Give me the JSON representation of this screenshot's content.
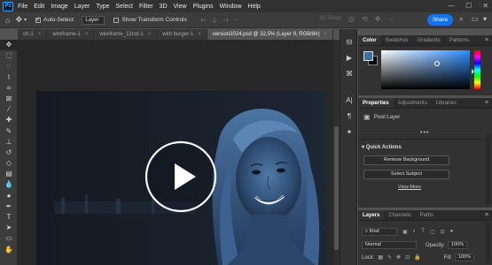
{
  "app": {
    "logo": "Ps"
  },
  "menu": [
    "File",
    "Edit",
    "Image",
    "Layer",
    "Type",
    "Select",
    "Filter",
    "3D",
    "View",
    "Plugins",
    "Window",
    "Help"
  ],
  "window_controls": {
    "minimize": "—",
    "maximize": "☐",
    "close": "✕"
  },
  "options": {
    "auto_select_label": "Auto-Select:",
    "auto_select_checked": true,
    "auto_select_value": "Layer",
    "transform_label": "Show Transform Controls",
    "transform_checked": false,
    "mode_3d_label": "3D Mode:",
    "share_label": "Share"
  },
  "tabs": [
    {
      "label": "ch-1",
      "active": false
    },
    {
      "label": "wireframe-1",
      "active": false
    },
    {
      "label": "wireframe_12col-1",
      "active": false
    },
    {
      "label": "with burger-1",
      "active": false
    },
    {
      "label": "version2024.psd @ 32,5% (Layer 9, RGB/8#)",
      "active": true
    }
  ],
  "tab_close": "×",
  "tools": [
    "move-tool-icon",
    "marquee-tool-icon",
    "lasso-tool-icon",
    "quick-select-tool-icon",
    "crop-tool-icon",
    "frame-tool-icon",
    "eyedropper-tool-icon",
    "healing-brush-tool-icon",
    "brush-tool-icon",
    "clone-stamp-tool-icon",
    "history-brush-tool-icon",
    "eraser-tool-icon",
    "gradient-tool-icon",
    "blur-tool-icon",
    "dodge-tool-icon",
    "pen-tool-icon",
    "type-tool-icon",
    "path-select-tool-icon",
    "rectangle-tool-icon",
    "hand-tool-icon"
  ],
  "colors": {
    "foreground": "#3f6fa5",
    "background": "#000000",
    "accent": "#1473e6"
  },
  "color_panel": {
    "tabs": [
      "Color",
      "Swatches",
      "Gradients",
      "Patterns"
    ]
  },
  "properties_panel": {
    "tabs": [
      "Properties",
      "Adjustments",
      "Libraries"
    ],
    "layer_type": "Pixel Layer",
    "quick_actions_label": "Quick Actions",
    "remove_bg_label": "Remove Background",
    "select_subject_label": "Select Subject",
    "view_more_label": "View More",
    "more_dots": "•••"
  },
  "layers_panel": {
    "tabs": [
      "Layers",
      "Channels",
      "Paths"
    ],
    "filter_label": "Kind",
    "blend_mode": "Normal",
    "opacity_label": "Opacity:",
    "opacity_value": "100%",
    "lock_label": "Lock:",
    "fill_label": "Fill:",
    "fill_value": "100%"
  },
  "panel_menu": "≡",
  "video": {
    "play_label": "▶"
  }
}
